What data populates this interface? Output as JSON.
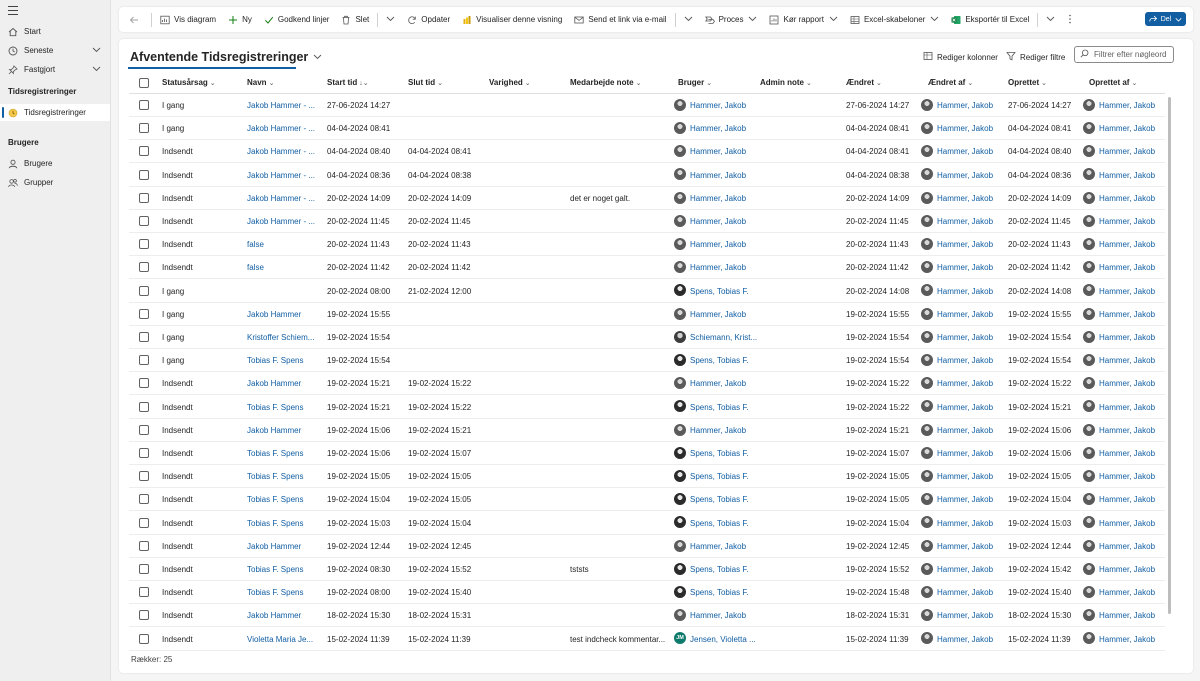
{
  "sidebar": {
    "items_top": [
      {
        "label": "Start",
        "icon": "home-icon"
      },
      {
        "label": "Seneste",
        "icon": "clock-icon"
      },
      {
        "label": "Fastgjort",
        "icon": "pin-icon"
      }
    ],
    "section1": "Tidsregistreringer",
    "section1_item": "Tidsregistreringer",
    "section2": "Brugere",
    "section2_items": [
      {
        "label": "Brugere",
        "icon": "user-icon"
      },
      {
        "label": "Grupper",
        "icon": "group-icon"
      }
    ]
  },
  "commandbar": {
    "vis_diagram": "Vis diagram",
    "ny": "Ny",
    "godkend": "Godkend linjer",
    "slet": "Slet",
    "opdater": "Opdater",
    "visualiser": "Visualiser denne visning",
    "send_link": "Send et link via e-mail",
    "proces": "Proces",
    "koer_rapport": "Kør rapport",
    "excel_skabeloner": "Excel-skabeloner",
    "eksporter": "Eksportér til Excel",
    "del": "Del"
  },
  "view": {
    "title": "Afventende Tidsregistreringer",
    "edit_columns": "Rediger kolonner",
    "edit_filters": "Rediger filtre",
    "search_placeholder": "Filtrer efter nøgleord",
    "footer": "Rækker: 25"
  },
  "columns": [
    "Statusårsag",
    "Navn",
    "Start tid",
    "Slut tid",
    "Varighed",
    "Medarbejde note",
    "Bruger",
    "Admin note",
    "Ændret",
    "Ændret af",
    "Oprettet",
    "Oprettet af"
  ],
  "rows": [
    {
      "status": "I gang",
      "name": "Jakob Hammer - ...",
      "start": "27-06-2024 14:27",
      "end": "",
      "note": "",
      "user": "Hammer, Jakob",
      "ua": "p1",
      "changed": "27-06-2024 14:27",
      "changed_by": "Hammer, Jakob",
      "created": "27-06-2024 14:27",
      "created_by": "Hammer, Jakob"
    },
    {
      "status": "I gang",
      "name": "Jakob Hammer - ...",
      "start": "04-04-2024 08:41",
      "end": "",
      "note": "",
      "user": "Hammer, Jakob",
      "ua": "p1",
      "changed": "04-04-2024 08:41",
      "changed_by": "Hammer, Jakob",
      "created": "04-04-2024 08:41",
      "created_by": "Hammer, Jakob"
    },
    {
      "status": "Indsendt",
      "name": "Jakob Hammer - ...",
      "start": "04-04-2024 08:40",
      "end": "04-04-2024 08:41",
      "note": "",
      "user": "Hammer, Jakob",
      "ua": "p1",
      "changed": "04-04-2024 08:41",
      "changed_by": "Hammer, Jakob",
      "created": "04-04-2024 08:40",
      "created_by": "Hammer, Jakob"
    },
    {
      "status": "Indsendt",
      "name": "Jakob Hammer - ...",
      "start": "04-04-2024 08:36",
      "end": "04-04-2024 08:38",
      "note": "",
      "user": "Hammer, Jakob",
      "ua": "p1",
      "changed": "04-04-2024 08:38",
      "changed_by": "Hammer, Jakob",
      "created": "04-04-2024 08:36",
      "created_by": "Hammer, Jakob"
    },
    {
      "status": "Indsendt",
      "name": "Jakob Hammer - ...",
      "start": "20-02-2024 14:09",
      "end": "20-02-2024 14:09",
      "note": "det er noget galt.",
      "user": "Hammer, Jakob",
      "ua": "p1",
      "changed": "20-02-2024 14:09",
      "changed_by": "Hammer, Jakob",
      "created": "20-02-2024 14:09",
      "created_by": "Hammer, Jakob"
    },
    {
      "status": "Indsendt",
      "name": "Jakob Hammer - ...",
      "start": "20-02-2024 11:45",
      "end": "20-02-2024 11:45",
      "note": "",
      "user": "Hammer, Jakob",
      "ua": "p1",
      "changed": "20-02-2024 11:45",
      "changed_by": "Hammer, Jakob",
      "created": "20-02-2024 11:45",
      "created_by": "Hammer, Jakob"
    },
    {
      "status": "Indsendt",
      "name": "false",
      "start": "20-02-2024 11:43",
      "end": "20-02-2024 11:43",
      "note": "",
      "user": "Hammer, Jakob",
      "ua": "p1",
      "changed": "20-02-2024 11:43",
      "changed_by": "Hammer, Jakob",
      "created": "20-02-2024 11:43",
      "created_by": "Hammer, Jakob"
    },
    {
      "status": "Indsendt",
      "name": "false",
      "start": "20-02-2024 11:42",
      "end": "20-02-2024 11:42",
      "note": "",
      "user": "Hammer, Jakob",
      "ua": "p1",
      "changed": "20-02-2024 11:42",
      "changed_by": "Hammer, Jakob",
      "created": "20-02-2024 11:42",
      "created_by": "Hammer, Jakob"
    },
    {
      "status": "I gang",
      "name": "",
      "start": "20-02-2024 08:00",
      "end": "21-02-2024 12:00",
      "note": "",
      "user": "Spens, Tobias F.",
      "ua": "p2",
      "changed": "20-02-2024 14:08",
      "changed_by": "Hammer, Jakob",
      "created": "20-02-2024 14:08",
      "created_by": "Hammer, Jakob"
    },
    {
      "status": "I gang",
      "name": "Jakob Hammer",
      "start": "19-02-2024 15:55",
      "end": "",
      "note": "",
      "user": "Hammer, Jakob",
      "ua": "p1",
      "changed": "19-02-2024 15:55",
      "changed_by": "Hammer, Jakob",
      "created": "19-02-2024 15:55",
      "created_by": "Hammer, Jakob"
    },
    {
      "status": "I gang",
      "name": "Kristoffer Schiem...",
      "start": "19-02-2024 15:54",
      "end": "",
      "note": "",
      "user": "Schiemann, Krist...",
      "ua": "p3",
      "changed": "19-02-2024 15:54",
      "changed_by": "Hammer, Jakob",
      "created": "19-02-2024 15:54",
      "created_by": "Hammer, Jakob"
    },
    {
      "status": "I gang",
      "name": "Tobias F. Spens",
      "start": "19-02-2024 15:54",
      "end": "",
      "note": "",
      "user": "Spens, Tobias F.",
      "ua": "p2",
      "changed": "19-02-2024 15:54",
      "changed_by": "Hammer, Jakob",
      "created": "19-02-2024 15:54",
      "created_by": "Hammer, Jakob"
    },
    {
      "status": "Indsendt",
      "name": "Jakob Hammer",
      "start": "19-02-2024 15:21",
      "end": "19-02-2024 15:22",
      "note": "",
      "user": "Hammer, Jakob",
      "ua": "p1",
      "changed": "19-02-2024 15:22",
      "changed_by": "Hammer, Jakob",
      "created": "19-02-2024 15:22",
      "created_by": "Hammer, Jakob"
    },
    {
      "status": "Indsendt",
      "name": "Tobias F. Spens",
      "start": "19-02-2024 15:21",
      "end": "19-02-2024 15:22",
      "note": "",
      "user": "Spens, Tobias F.",
      "ua": "p2",
      "changed": "19-02-2024 15:22",
      "changed_by": "Hammer, Jakob",
      "created": "19-02-2024 15:21",
      "created_by": "Hammer, Jakob"
    },
    {
      "status": "Indsendt",
      "name": "Jakob Hammer",
      "start": "19-02-2024 15:06",
      "end": "19-02-2024 15:21",
      "note": "",
      "user": "Hammer, Jakob",
      "ua": "p1",
      "changed": "19-02-2024 15:21",
      "changed_by": "Hammer, Jakob",
      "created": "19-02-2024 15:06",
      "created_by": "Hammer, Jakob"
    },
    {
      "status": "Indsendt",
      "name": "Tobias F. Spens",
      "start": "19-02-2024 15:06",
      "end": "19-02-2024 15:07",
      "note": "",
      "user": "Spens, Tobias F.",
      "ua": "p2",
      "changed": "19-02-2024 15:07",
      "changed_by": "Hammer, Jakob",
      "created": "19-02-2024 15:06",
      "created_by": "Hammer, Jakob"
    },
    {
      "status": "Indsendt",
      "name": "Tobias F. Spens",
      "start": "19-02-2024 15:05",
      "end": "19-02-2024 15:05",
      "note": "",
      "user": "Spens, Tobias F.",
      "ua": "p2",
      "changed": "19-02-2024 15:05",
      "changed_by": "Hammer, Jakob",
      "created": "19-02-2024 15:05",
      "created_by": "Hammer, Jakob"
    },
    {
      "status": "Indsendt",
      "name": "Tobias F. Spens",
      "start": "19-02-2024 15:04",
      "end": "19-02-2024 15:05",
      "note": "",
      "user": "Spens, Tobias F.",
      "ua": "p2",
      "changed": "19-02-2024 15:05",
      "changed_by": "Hammer, Jakob",
      "created": "19-02-2024 15:04",
      "created_by": "Hammer, Jakob"
    },
    {
      "status": "Indsendt",
      "name": "Tobias F. Spens",
      "start": "19-02-2024 15:03",
      "end": "19-02-2024 15:04",
      "note": "",
      "user": "Spens, Tobias F.",
      "ua": "p2",
      "changed": "19-02-2024 15:04",
      "changed_by": "Hammer, Jakob",
      "created": "19-02-2024 15:03",
      "created_by": "Hammer, Jakob"
    },
    {
      "status": "Indsendt",
      "name": "Jakob Hammer",
      "start": "19-02-2024 12:44",
      "end": "19-02-2024 12:45",
      "note": "",
      "user": "Hammer, Jakob",
      "ua": "p1",
      "changed": "19-02-2024 12:45",
      "changed_by": "Hammer, Jakob",
      "created": "19-02-2024 12:44",
      "created_by": "Hammer, Jakob"
    },
    {
      "status": "Indsendt",
      "name": "Tobias F. Spens",
      "start": "19-02-2024 08:30",
      "end": "19-02-2024 15:52",
      "note": "tststs",
      "user": "Spens, Tobias F.",
      "ua": "p2",
      "changed": "19-02-2024 15:52",
      "changed_by": "Hammer, Jakob",
      "created": "19-02-2024 15:42",
      "created_by": "Hammer, Jakob"
    },
    {
      "status": "Indsendt",
      "name": "Tobias F. Spens",
      "start": "19-02-2024 08:00",
      "end": "19-02-2024 15:40",
      "note": "",
      "user": "Spens, Tobias F.",
      "ua": "p2",
      "changed": "19-02-2024 15:48",
      "changed_by": "Hammer, Jakob",
      "created": "19-02-2024 15:40",
      "created_by": "Hammer, Jakob"
    },
    {
      "status": "Indsendt",
      "name": "Jakob Hammer",
      "start": "18-02-2024 15:30",
      "end": "18-02-2024 15:31",
      "note": "",
      "user": "Hammer, Jakob",
      "ua": "p1",
      "changed": "18-02-2024 15:31",
      "changed_by": "Hammer, Jakob",
      "created": "18-02-2024 15:30",
      "created_by": "Hammer, Jakob"
    },
    {
      "status": "Indsendt",
      "name": "Violetta Maria Je...",
      "start": "15-02-2024 11:39",
      "end": "15-02-2024 11:39",
      "note": "test indcheck kommentar...",
      "user": "Jensen, Violetta ...",
      "ua": "ini",
      "ui": "JM",
      "changed": "15-02-2024 11:39",
      "changed_by": "Hammer, Jakob",
      "created": "15-02-2024 11:39",
      "created_by": "Hammer, Jakob"
    }
  ],
  "colors": {
    "accent": "#115ea3",
    "link": "#115ea3"
  }
}
